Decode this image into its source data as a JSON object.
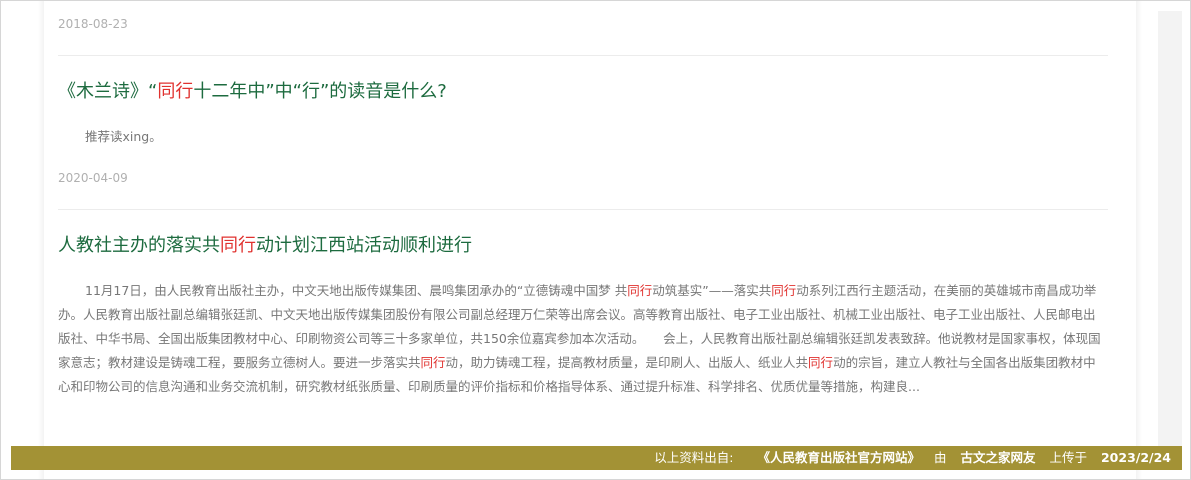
{
  "results": [
    {
      "date": "2018-08-23"
    },
    {
      "title_parts": [
        "《木兰诗》“",
        "同行",
        "十二年中”中“行”的读音是什么?"
      ],
      "snippet_parts": [
        "推荐读xing。"
      ],
      "date": "2020-04-09"
    },
    {
      "title_parts": [
        "人教社主办的落实共",
        "同行",
        "动计划江西站活动顺利进行"
      ],
      "snippet_parts": [
        "11月17日，由人民教育出版社主办，中文天地出版传媒集团、晨鸣集团承办的“立德铸魂中国梦 共",
        "同行",
        "动筑基实”——落实共",
        "同行",
        "动系列江西行主题活动，在美丽的英雄城市南昌成功举办。人民教育出版社副总编辑张廷凯、中文天地出版传媒集团股份有限公司副总经理万仁荣等出席会议。高等教育出版社、电子工业出版社、机械工业出版社、电子工业出版社、人民邮电出版社、中华书局、全国出版集团教材中心、印刷物资公司等三十多家单位，共150余位嘉宾参加本次活动。　　会上，人民教育出版社副总编辑张廷凯发表致辞。他说教材是国家事权，体现国家意志；教材建设是铸魂工程，要服务立德树人。要进一步落实共",
        "同行",
        "动，助力铸魂工程，提高教材质量，是印刷人、出版人、纸业人共",
        "同行",
        "动的宗旨，建立人教社与全国各出版集团教材中心和印物公司的信息沟通和业务交流机制，研究教材纸张质量、印刷质量的评价指标和价格指导体系、通过提升标准、科学排名、优质优量等措施，构建良..."
      ]
    }
  ],
  "footer": {
    "source_label": "以上资料出自:",
    "source_name": "《人民教育出版社官方网站》",
    "by_label": "由",
    "uploader": "古文之家网友",
    "uploaded_label": "上传于",
    "upload_date": "2023/2/24"
  },
  "colors": {
    "title": "#1d6b3f",
    "highlight": "#e0322f",
    "footer_bg": "#a39235",
    "date": "#b0b0b0",
    "snippet": "#777777"
  }
}
